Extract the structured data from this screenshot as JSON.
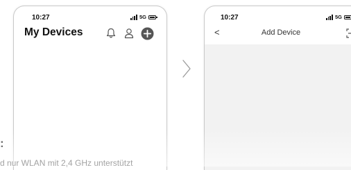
{
  "screen1": {
    "status": {
      "time": "10:27",
      "network": "5G"
    },
    "title": "My Devices",
    "icons": [
      "bell-icon",
      "user-icon",
      "add-icon"
    ]
  },
  "screen2": {
    "status": {
      "time": "10:27",
      "network": "5G"
    },
    "nav": {
      "back": "<",
      "title": "Add Device"
    },
    "icons": [
      "back-icon",
      "scan-icon"
    ]
  },
  "between_arrow": "chevron-right-icon",
  "bottom": {
    "label": ":",
    "text": "d nur WLAN mit 2,4 GHz unterstützt"
  },
  "colors": {
    "add_button": "#555555",
    "content_bg": "#f2f2f2",
    "frame": "#c9c9c9"
  }
}
